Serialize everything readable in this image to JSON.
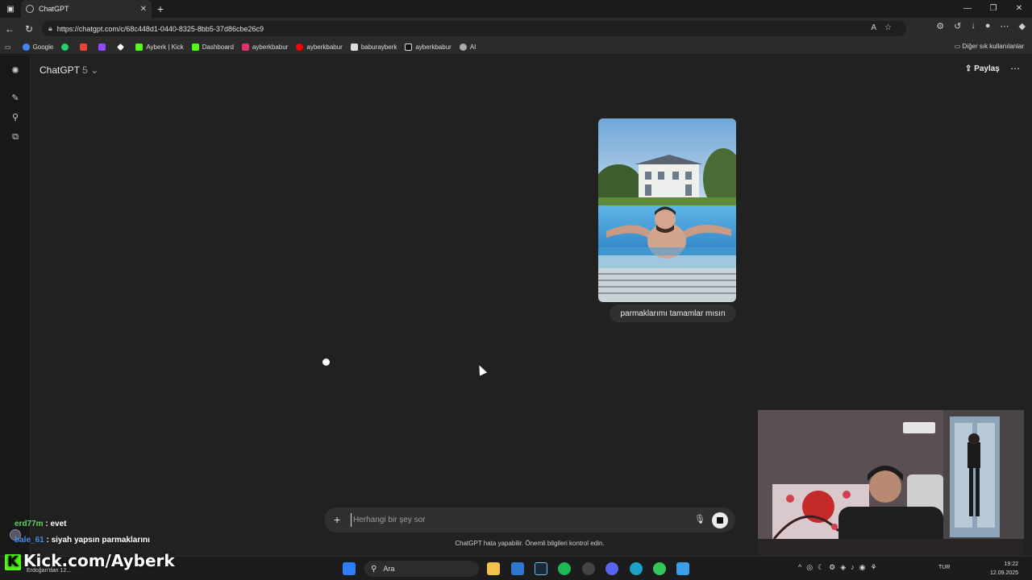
{
  "browser": {
    "tab_title": "ChatGPT",
    "tab_close": "✕",
    "new_tab": "+",
    "url": "https://chatgpt.com/c/68c448d1-0440-8325-8bb5-37d86cbe26c9",
    "window_controls": [
      "—",
      "❐",
      "✕"
    ]
  },
  "bookmarks": {
    "items": [
      {
        "label": "Google",
        "color": "#4285f4"
      },
      {
        "label": "",
        "color": "#25d366"
      },
      {
        "label": "",
        "color": "#ea4335"
      },
      {
        "label": "",
        "color": "#9146ff"
      },
      {
        "label": "",
        "color": "#ffffff"
      },
      {
        "label": "Ayberk | Kick",
        "color": "#53fc18"
      },
      {
        "label": "Dashboard",
        "color": "#53fc18"
      },
      {
        "label": "ayberkbabur",
        "color": "#e1306c"
      },
      {
        "label": "ayberkbabur",
        "color": "#ff0000"
      },
      {
        "label": "baburayberk",
        "color": "#ffffff"
      },
      {
        "label": "ayberkbabur",
        "color": "#000000"
      },
      {
        "label": "AI",
        "color": "#aaaaaa"
      }
    ],
    "other": "Diğer sık kullanılanlar"
  },
  "app": {
    "model_name": "ChatGPT",
    "model_version": "5",
    "share_label": "Paylaş",
    "more_icon": "⋯"
  },
  "conversation": {
    "user_message": "parmaklarımı tamamlar mısın"
  },
  "composer": {
    "placeholder": "Herhangi bir şey sor",
    "plus_icon": "+"
  },
  "disclaimer": "ChatGPT hata yapabilir. Önemli bilgileri kontrol edin.",
  "stream_chat": [
    {
      "user": "erd77m",
      "message": "evet"
    },
    {
      "user": "bale_61",
      "message": "siyah yapsın parmaklarını"
    }
  ],
  "kick_banner": "Kick.com/Ayberk",
  "kick_letter": "K",
  "kick_sub": "Erdoğan'dan 12...",
  "taskbar": {
    "search_label": "Ara",
    "language": "TUR",
    "time": "19:22",
    "date": "12.09.2025"
  }
}
